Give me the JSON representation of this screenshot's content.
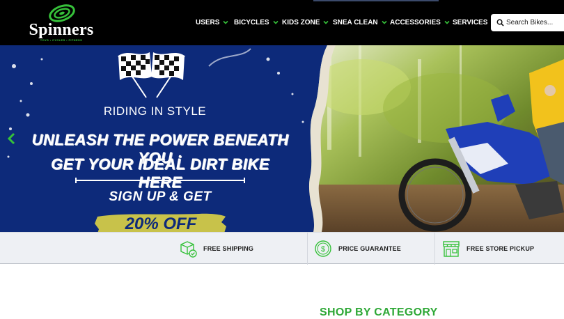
{
  "header": {
    "logo": {
      "brand": "Spinners",
      "tagline": "TOYS • CYCLES • FITNESS"
    },
    "nav": [
      {
        "label": "USERS",
        "has_dropdown": true
      },
      {
        "label": "BICYCLES",
        "has_dropdown": true
      },
      {
        "label": "KIDS ZONE",
        "has_dropdown": true
      },
      {
        "label": "SNEA CLEAN",
        "has_dropdown": true
      },
      {
        "label": "ACCESSORIES",
        "has_dropdown": true
      },
      {
        "label": "SERVICES",
        "has_dropdown": false
      }
    ],
    "search": {
      "placeholder": "Search Bikes...",
      "icon": "search-icon"
    }
  },
  "hero": {
    "kicker": "RIDING IN STYLE",
    "headline_line1": "UNLEASH THE POWER BENEATH YOU :",
    "headline_line2": "GET YOUR IDEAL DIRT BIKE HERE",
    "signup": "SIGN UP & GET",
    "offer": "20% OFF",
    "prev_icon": "chevron-left-icon",
    "colors": {
      "panel": "#0d2a7a",
      "accent_band": "#c8c24a",
      "arrow": "#36c13a"
    }
  },
  "features": [
    {
      "icon": "package-check-icon",
      "label": "FREE SHIPPING"
    },
    {
      "icon": "dollar-coin-icon",
      "label": "PRICE GUARANTEE"
    },
    {
      "icon": "storefront-icon",
      "label": "FREE STORE PICKUP"
    }
  ],
  "main": {
    "section_title": "SHOP BY CATEGORY"
  },
  "colors": {
    "brand_green": "#36c13a",
    "topbar": "#000000",
    "features_bg": "#eef0f4"
  }
}
